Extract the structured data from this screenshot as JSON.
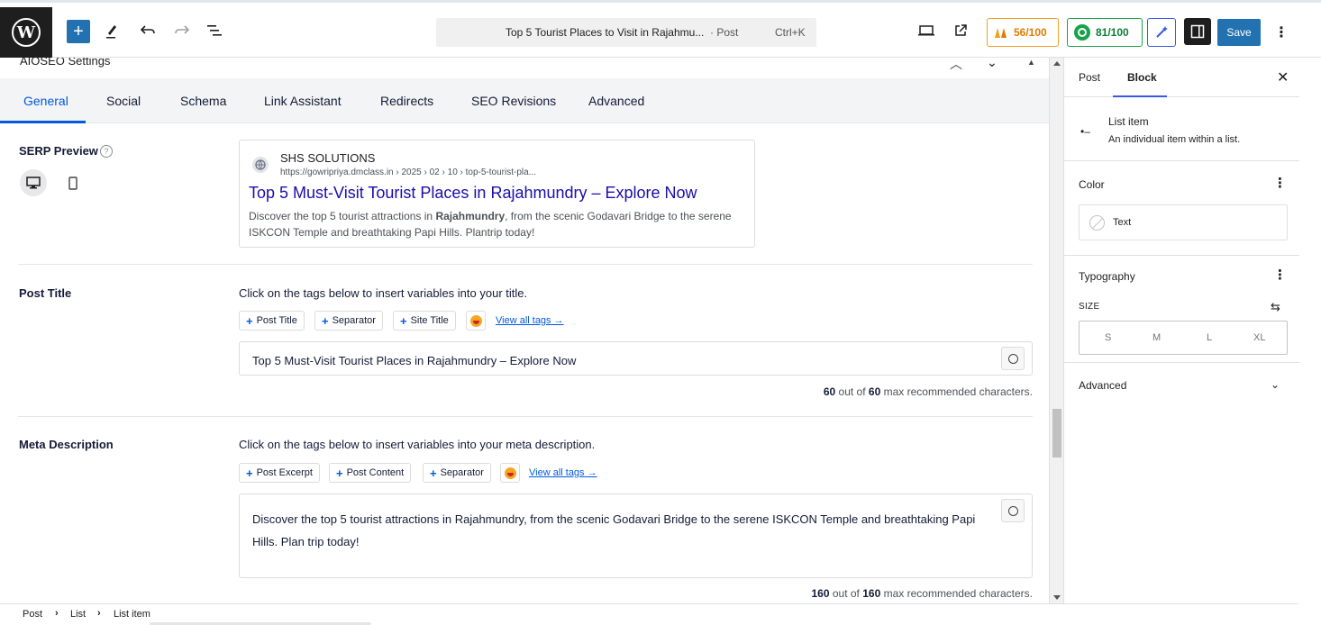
{
  "toolbar": {
    "doc_title": "Top 5 Tourist Places to Visit in Rajahmu...",
    "doc_type": "· Post",
    "shortcut": "Ctrl+K",
    "seo_score": "56/100",
    "truseo_score": "81/100",
    "save_label": "Save",
    "colors": {
      "accent": "#2271b1",
      "seo": "#e07b00",
      "truseo": "#107a36"
    }
  },
  "aioseo": {
    "header_title": "AIOSEO Settings",
    "tabs": [
      {
        "label": "General",
        "active": true
      },
      {
        "label": "Social"
      },
      {
        "label": "Schema"
      },
      {
        "label": "Link Assistant"
      },
      {
        "label": "Redirects"
      },
      {
        "label": "SEO Revisions"
      },
      {
        "label": "Advanced"
      }
    ],
    "serp": {
      "label": "SERP Preview",
      "help": "?",
      "site_name": "SHS SOLUTIONS",
      "url": "https://gowripriya.dmclass.in › 2025 › 02 › 10 › top-5-tourist-pla...",
      "title": "Top 5 Must-Visit Tourist Places in Rajahmundry – Explore Now",
      "desc_before": "Discover the top 5 tourist attractions in ",
      "desc_bold": "Rajahmundry",
      "desc_after": ", from the scenic Godavari Bridge to the serene ISKCON Temple and breathtaking Papi Hills. Plantrip today!"
    },
    "post_title": {
      "label": "Post Title",
      "helper": "Click on the tags below to insert variables into your title.",
      "tags": [
        "Post Title",
        "Separator",
        "Site Title"
      ],
      "view_all": "View all tags →",
      "value": "Top 5 Must-Visit Tourist Places in Rajahmundry – Explore Now",
      "count": "60",
      "max": "60",
      "count_suffix": "max recommended characters.",
      "out_of": "out of"
    },
    "meta_description": {
      "label": "Meta Description",
      "helper": "Click on the tags below to insert variables into your meta description.",
      "tags": [
        "Post Excerpt",
        "Post Content",
        "Separator"
      ],
      "view_all": "View all tags →",
      "line1": "Discover the top 5 tourist attractions in Rajahmundry, from the scenic Godavari Bridge to the serene ISKCON Temple and breathtaking Papi",
      "line2": "Hills. Plan trip today!",
      "count": "160",
      "max": "160",
      "count_suffix": "max recommended characters.",
      "out_of": "out of"
    }
  },
  "sidebar": {
    "tabs": [
      "Post",
      "Block"
    ],
    "active_tab": "Block",
    "block_name": "List item",
    "block_desc": "An individual item within a list.",
    "color_title": "Color",
    "color_text": "Text",
    "typography_title": "Typography",
    "size_label": "SIZE",
    "sizes": [
      "S",
      "M",
      "L",
      "XL"
    ],
    "advanced_title": "Advanced"
  },
  "breadcrumb": [
    "Post",
    "List",
    "List item"
  ]
}
